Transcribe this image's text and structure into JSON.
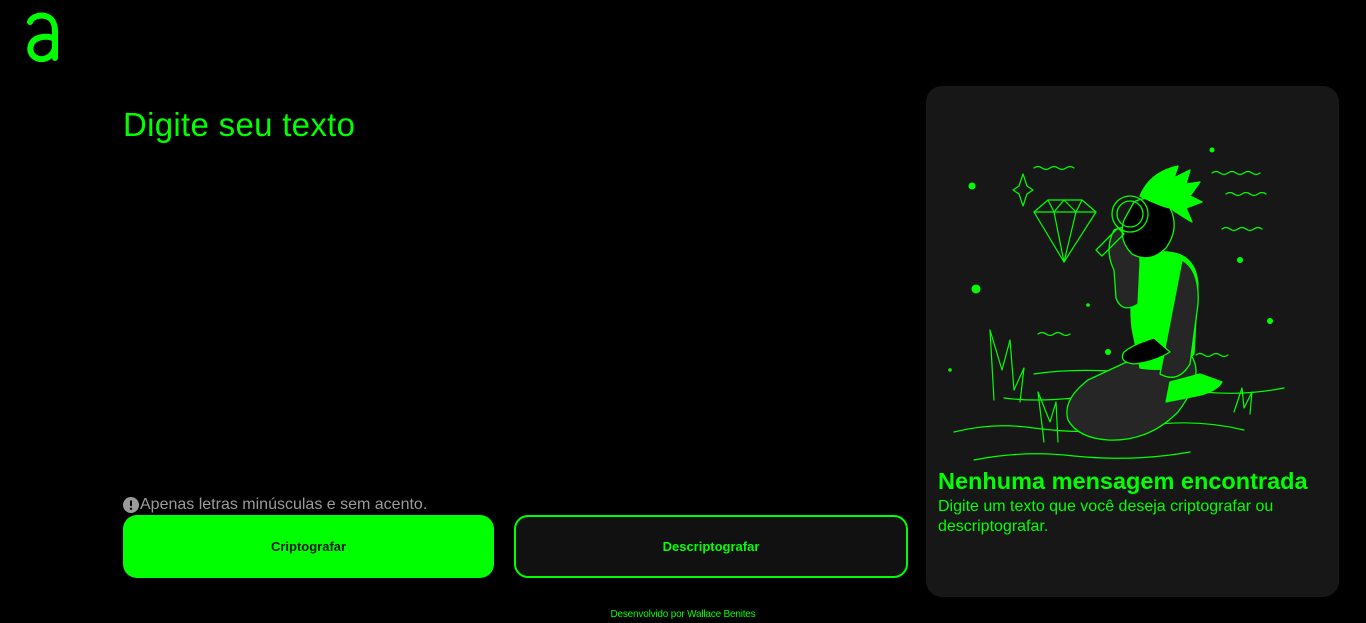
{
  "brand": {
    "logo_icon": "alura-logo-icon",
    "accent": "#00ff00"
  },
  "input": {
    "title": "Digite seu texto",
    "value": "",
    "placeholder": ""
  },
  "hint": {
    "icon": "exclamation-icon",
    "text": "Apenas letras minúsculas e sem acento."
  },
  "buttons": {
    "encrypt_label": "Criptografar",
    "decrypt_label": "Descriptografar"
  },
  "output": {
    "illustration_icon": "person-with-magnifier-illustration",
    "title": "Nenhuma mensagem encontrada",
    "text": "Digite um texto que você deseja criptografar ou descriptografar."
  },
  "footer": {
    "text": "Desenvolvido por Wallace Benites"
  }
}
